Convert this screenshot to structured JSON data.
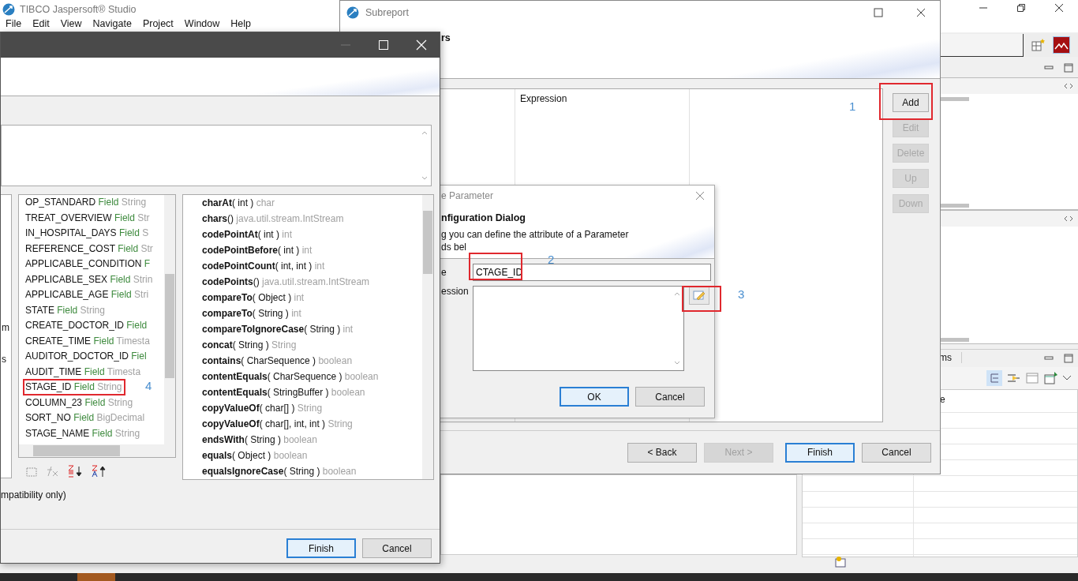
{
  "app": {
    "title": "TIBCO Jaspersoft® Studio",
    "menu": [
      "File",
      "Edit",
      "View",
      "Navigate",
      "Project",
      "Window",
      "Help"
    ],
    "panel_tab": "ms",
    "panel_label": "e"
  },
  "subreport": {
    "title": "Subreport",
    "heading": "rs",
    "column": "Expression",
    "side_buttons": [
      {
        "label": "Add",
        "disabled": false
      },
      {
        "label": "Edit",
        "disabled": true
      },
      {
        "label": "Delete",
        "disabled": true
      },
      {
        "label": "Up",
        "disabled": true
      },
      {
        "label": "Down",
        "disabled": true
      }
    ],
    "nav_buttons": [
      {
        "label": "< Back",
        "disabled": false,
        "default": false
      },
      {
        "label": "Next >",
        "disabled": true,
        "default": false
      },
      {
        "label": "Finish",
        "disabled": false,
        "default": true
      },
      {
        "label": "Cancel",
        "disabled": false,
        "default": false
      }
    ]
  },
  "parameter_dialog": {
    "title": "e Parameter",
    "heading": "nfiguration Dialog",
    "description": [
      "g you can define the attribute of a Parameter",
      "ds bel"
    ],
    "name_label": "e",
    "name_value": "CTAGE_ID",
    "expression_label": "ession",
    "buttons": [
      {
        "label": "OK",
        "default": true
      },
      {
        "label": "Cancel",
        "default": false
      }
    ]
  },
  "expression_editor": {
    "left_fragments": [
      "m",
      "s"
    ],
    "fields": [
      {
        "name": "OP_STANDARD",
        "kind": "Field",
        "type": "String"
      },
      {
        "name": "TREAT_OVERVIEW",
        "kind": "Field",
        "type": "Str"
      },
      {
        "name": "IN_HOSPITAL_DAYS",
        "kind": "Field",
        "type": "S"
      },
      {
        "name": "REFERENCE_COST",
        "kind": "Field",
        "type": "Str"
      },
      {
        "name": "APPLICABLE_CONDITION",
        "kind": "F"
      },
      {
        "name": "APPLICABLE_SEX",
        "kind": "Field",
        "type": "Strin"
      },
      {
        "name": "APPLICABLE_AGE",
        "kind": "Field",
        "type": "Stri"
      },
      {
        "name": "STATE",
        "kind": "Field",
        "type": "String"
      },
      {
        "name": "CREATE_DOCTOR_ID",
        "kind": "Field"
      },
      {
        "name": "CREATE_TIME",
        "kind": "Field",
        "type": "Timesta"
      },
      {
        "name": "AUDITOR_DOCTOR_ID",
        "kind": "Fiel"
      },
      {
        "name": "AUDIT_TIME",
        "kind": "Field",
        "type": "Timesta"
      },
      {
        "name": "STAGE_ID",
        "kind": "Field",
        "type": "String"
      },
      {
        "name": "COLUMN_23",
        "kind": "Field",
        "type": "String"
      },
      {
        "name": "SORT_NO",
        "kind": "Field",
        "type": "BigDecimal"
      },
      {
        "name": "STAGE_NAME",
        "kind": "Field",
        "type": "String"
      }
    ],
    "methods": [
      {
        "name": "charAt",
        "args": "( int )",
        "returns": "char"
      },
      {
        "name": "chars",
        "args": "()",
        "returns": "java.util.stream.IntStream"
      },
      {
        "name": "codePointAt",
        "args": "( int )",
        "returns": "int"
      },
      {
        "name": "codePointBefore",
        "args": "( int )",
        "returns": "int"
      },
      {
        "name": "codePointCount",
        "args": "( int, int )",
        "returns": "int"
      },
      {
        "name": "codePoints",
        "args": "()",
        "returns": "java.util.stream.IntStream"
      },
      {
        "name": "compareTo",
        "args": "( Object )",
        "returns": "int"
      },
      {
        "name": "compareTo",
        "args": "( String )",
        "returns": "int"
      },
      {
        "name": "compareToIgnoreCase",
        "args": "( String )",
        "returns": "int"
      },
      {
        "name": "concat",
        "args": "( String )",
        "returns": "String"
      },
      {
        "name": "contains",
        "args": "( CharSequence )",
        "returns": "boolean"
      },
      {
        "name": "contentEquals",
        "args": "( CharSequence )",
        "returns": "boolean"
      },
      {
        "name": "contentEquals",
        "args": "( StringBuffer )",
        "returns": "boolean"
      },
      {
        "name": "copyValueOf",
        "args": "( char[] )",
        "returns": "String"
      },
      {
        "name": "copyValueOf",
        "args": "( char[], int, int )",
        "returns": "String"
      },
      {
        "name": "endsWith",
        "args": "( String )",
        "returns": "boolean"
      },
      {
        "name": "equals",
        "args": "( Object )",
        "returns": "boolean"
      },
      {
        "name": "equalsIgnoreCase",
        "args": "( String )",
        "returns": "boolean"
      }
    ],
    "note": "mpatibility only)",
    "buttons": [
      {
        "label": "Finish",
        "default": true
      },
      {
        "label": "Cancel",
        "default": false
      }
    ]
  },
  "annotations": [
    {
      "label": "1"
    },
    {
      "label": "2"
    },
    {
      "label": "3"
    },
    {
      "label": "4"
    }
  ]
}
